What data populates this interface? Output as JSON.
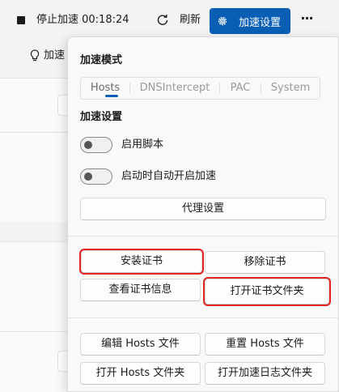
{
  "topbar": {
    "stop_label": "停止加速 00:18:24",
    "refresh_label": "刷新",
    "accel_settings_label": "加速设置",
    "more_label": "···"
  },
  "background": {
    "left_label": "加速"
  },
  "flyout": {
    "mode_title": "加速模式",
    "tabs": [
      {
        "label": "Hosts",
        "selected": true
      },
      {
        "label": "DNSIntercept",
        "selected": false
      },
      {
        "label": "PAC",
        "selected": false
      },
      {
        "label": "System",
        "selected": false
      }
    ],
    "settings_title": "加速设置",
    "toggles": [
      {
        "label": "启用脚本",
        "on": false
      },
      {
        "label": "启动时自动开启加速",
        "on": false
      }
    ],
    "proxy_settings_label": "代理设置",
    "cert_buttons": {
      "install": "安装证书",
      "remove": "移除证书",
      "view_info": "查看证书信息",
      "open_folder": "打开证书文件夹"
    },
    "hosts_buttons": {
      "edit": "编辑 Hosts 文件",
      "reset": "重置 Hosts 文件",
      "open": "打开 Hosts 文件夹",
      "open_log": "打开加速日志文件夹"
    }
  },
  "colors": {
    "accent": "#0a5fb4",
    "highlight": "#e5231f"
  }
}
